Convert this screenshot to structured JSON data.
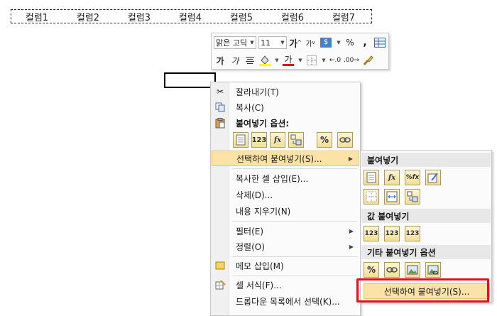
{
  "sheet": {
    "copied_headers": [
      "컬럼1",
      "컬럼2",
      "컬럼3",
      "컬럼4",
      "컬럼5",
      "컬럼6",
      "컬럼7"
    ]
  },
  "mini_toolbar": {
    "font_name": "맑은 고딕",
    "font_size": "11",
    "grow_font": "가",
    "shrink_font": "가",
    "accounting_icon": "$",
    "percent": "%",
    "comma": ",",
    "bold": "가",
    "italic": "가",
    "font_color_label": "가",
    "decimal_increase": ".0",
    "decimal_decrease": ".00"
  },
  "context_menu": {
    "cut": "잘라내기(T)",
    "copy": "복사(C)",
    "paste_options_header": "붙여넣기 옵션:",
    "paste_icons": [
      "",
      "123",
      "fx",
      "",
      "%",
      ""
    ],
    "paste_special": "선택하여 붙여넣기(S)...",
    "insert_copied": "복사한 셀 삽입(E)...",
    "delete": "삭제(D)...",
    "clear_contents": "내용 지우기(N)",
    "filter": "필터(E)",
    "sort": "정렬(O)",
    "insert_comment": "메모 삽입(M)",
    "format_cells": "셀 서식(F)...",
    "pick_from_list": "드롭다운 목록에서 선택(K)..."
  },
  "submenu": {
    "paste_header": "붙여넣기",
    "paste_row1": [
      "",
      "fx",
      "%fx",
      ""
    ],
    "paste_row2": [
      "",
      "",
      ""
    ],
    "values_header": "값 붙여넣기",
    "values_row": [
      "123",
      "123",
      "123"
    ],
    "other_header": "기타 붙여넣기 옵션",
    "other_row": [
      "%",
      "",
      "",
      ""
    ],
    "paste_special_item": "선택하여 붙여넣기(S)..."
  },
  "colors": {
    "highlight": "#fbe2a6",
    "red_box": "#e0141e",
    "font_color_bar": "#e00000",
    "fill_color_bar": "#ffff00"
  }
}
